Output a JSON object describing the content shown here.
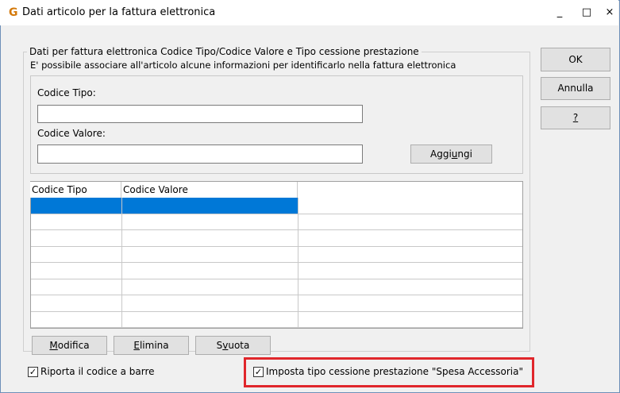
{
  "window": {
    "title": "Dati articolo per la fattura elettronica",
    "app_icon_glyph": "G",
    "minimize_glyph": "_",
    "maximize_glyph": "□",
    "close_glyph": "×"
  },
  "group": {
    "caption": "Dati per fattura elettronica Codice Tipo/Codice Valore e Tipo cessione prestazione",
    "description": "E' possibile associare all'articolo alcune informazioni per identificarlo nella fattura elettronica"
  },
  "form": {
    "codice_tipo_label": "Codice Tipo:",
    "codice_tipo_value": "",
    "codice_valore_label": "Codice Valore:",
    "codice_valore_value": "",
    "aggiungi_pre": "Aggi",
    "aggiungi_key": "u",
    "aggiungi_post": "ngi"
  },
  "grid": {
    "columns": [
      "Codice Tipo",
      "Codice Valore"
    ],
    "rows": [
      [
        "",
        ""
      ],
      [
        "",
        ""
      ],
      [
        "",
        ""
      ],
      [
        "",
        ""
      ],
      [
        "",
        ""
      ],
      [
        "",
        ""
      ],
      [
        "",
        ""
      ],
      [
        "",
        ""
      ]
    ],
    "selected_row": 0
  },
  "actions": {
    "modifica_key": "M",
    "modifica_rest": "odifica",
    "elimina_key": "E",
    "elimina_rest": "limina",
    "svuota_pre": "S",
    "svuota_key": "v",
    "svuota_post": "uota"
  },
  "dialog_buttons": {
    "ok": "OK",
    "annulla": "Annulla",
    "help": "?"
  },
  "options": {
    "riporta_codice_barre_label": "Riporta il codice a barre",
    "riporta_codice_barre_checked": true,
    "spesa_accessoria_label": "Imposta tipo cessione prestazione \"Spesa Accessoria\"",
    "spesa_accessoria_checked": true,
    "check_glyph": "✓"
  },
  "colors": {
    "selection": "#0078d7",
    "highlight_border": "#e0262b"
  }
}
